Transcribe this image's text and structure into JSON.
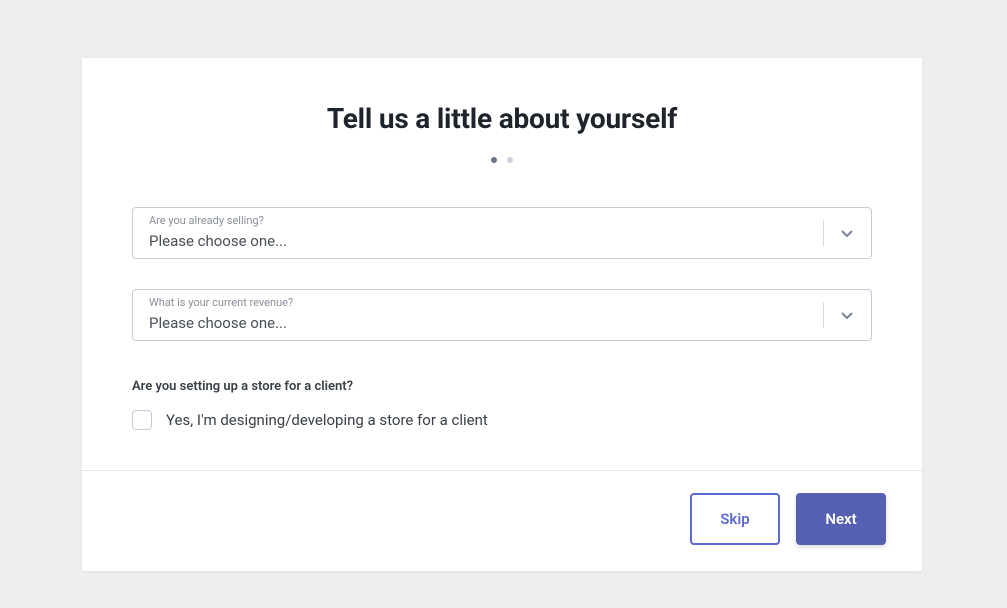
{
  "title": "Tell us a little about yourself",
  "pager": {
    "steps": 2,
    "current": 1
  },
  "fields": {
    "selling": {
      "label": "Are you already selling?",
      "value": "Please choose one..."
    },
    "revenue": {
      "label": "What is your current revenue?",
      "value": "Please choose one..."
    }
  },
  "client_question": {
    "label": "Are you setting up a store for a client?",
    "checkbox_label": "Yes, I'm designing/developing a store for a client"
  },
  "footer": {
    "skip": "Skip",
    "next": "Next"
  }
}
